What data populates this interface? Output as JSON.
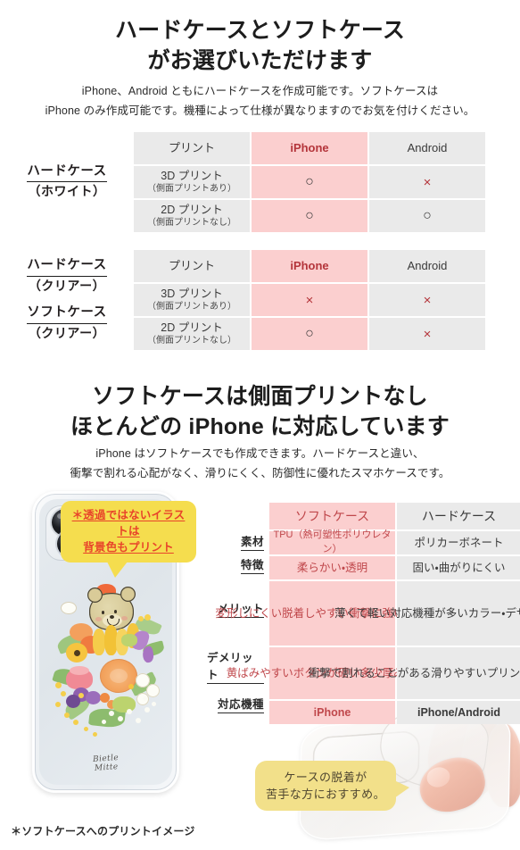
{
  "section1": {
    "heading_line1": "ハードケースとソフトケース",
    "heading_line2": "がお選びいただけます",
    "lede_line1": "iPhone、Android ともにハードケースを作成可能です。ソフトケースは",
    "lede_line2": "iPhone のみ作成可能です。機種によって仕様が異なりますのでお気を付けください。"
  },
  "table_hard_white": {
    "label_main": "ハードケース",
    "label_sub": "（ホワイト）",
    "headers": [
      "プリント",
      "iPhone",
      "Android"
    ],
    "rows": [
      {
        "print_main": "3D プリント",
        "print_sub": "（側面プリントあり）",
        "iphone": "○",
        "android": "×"
      },
      {
        "print_main": "2D プリント",
        "print_sub": "（側面プリントなし）",
        "iphone": "○",
        "android": "○"
      }
    ]
  },
  "table_clear": {
    "label_main_1": "ハードケース",
    "label_sub_1": "（クリアー）",
    "label_main_2": "ソフトケース",
    "label_sub_2": "（クリアー）",
    "headers": [
      "プリント",
      "iPhone",
      "Android"
    ],
    "rows": [
      {
        "print_main": "3D プリント",
        "print_sub": "（側面プリントあり）",
        "iphone": "×",
        "android": "×"
      },
      {
        "print_main": "2D プリント",
        "print_sub": "（側面プリントなし）",
        "iphone": "○",
        "android": "×"
      }
    ]
  },
  "section2": {
    "heading_line1": "ソフトケースは側面プリントなし",
    "heading_line2": "ほとんどの iPhone に対応しています",
    "lede_line1": "iPhone はソフトケースでも作成できます。ハードケースと違い、",
    "lede_line2": "衝撃で割れる心配がなく、滑りにくく、防御性に優れたスマホケースです。"
  },
  "compare_table": {
    "headers": [
      "ソフトケース",
      "ハードケース"
    ],
    "rows": [
      {
        "label": "素材",
        "soft": "TPU（熱可塑性ポリウレタン）",
        "hard": "ポリカーボネート"
      },
      {
        "label": "特徴",
        "soft": "柔らかい・透明",
        "hard": "固い・曲がりにくい"
      },
      {
        "label": "メリット",
        "soft": "変形しにくい\n脱着しやすい\n衝撃に強い\n割れない",
        "hard": "薄くて軽い\n対応機種が多い\nカラー・デザインが多い"
      },
      {
        "label": "デメリット",
        "soft": "黄ばみやすい\nボタンが硬い\n多少厚みがある",
        "hard": "衝撃で割れることがある\n滑りやすい\nプリントが剥がれやすい"
      },
      {
        "label": "対応機種",
        "soft": "iPhone",
        "hard": "iPhone/Android"
      }
    ]
  },
  "callout_print": {
    "line1": "＊透過ではないイラストは",
    "line2": "背景色もプリント"
  },
  "callout_recommend": {
    "line1": "ケースの脱着が",
    "line2": "苦手な方におすすめ。"
  },
  "footnote": "＊ソフトケースへのプリントイメージ",
  "phone_art": {
    "brand_line1": "Bietle",
    "brand_line2": "Mitte"
  },
  "colors": {
    "pink_cell": "#fbcfcf",
    "gray_cell": "#eaeaea",
    "accent_red": "#b4353b",
    "callout_yellow": "#f5dd4e",
    "callout_soft_yellow": "#f2e08a",
    "callout_text_red": "#e8442a"
  }
}
